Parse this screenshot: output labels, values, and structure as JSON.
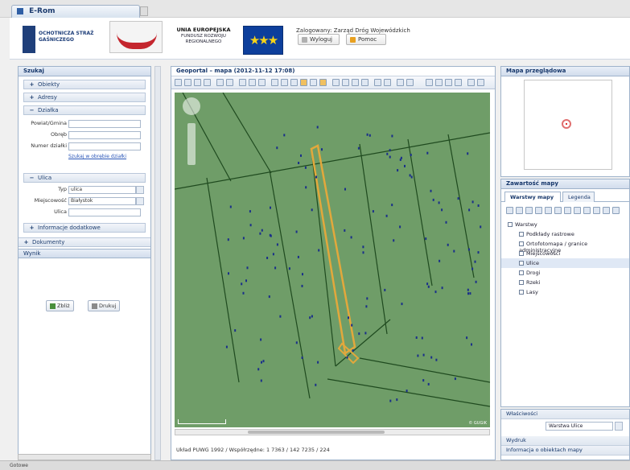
{
  "window": {
    "tab_title": "E-Rom"
  },
  "header": {
    "logo1_text": "OCHOTNICZA STRAŻ GAŚNICZEGO",
    "logo3_title": "UNIA EUROPEJSKA",
    "logo3_sub": "FUNDUSZ ROZWOJU REGIONALNEGO",
    "user_text": "Zalogowany: Zarząd Dróg Wojewódzkich",
    "btn_login": "Wyloguj",
    "btn_help": "Pomoc"
  },
  "left": {
    "title": "Szukaj",
    "acc_1": "Obiekty",
    "acc_2": "Adresy",
    "acc_3": "Działka",
    "field_1_label": "Powiat/Gmina",
    "field_2_label": "Obręb",
    "field_3_label": "Numer działki",
    "link_search": "Szukaj w obrębie działki",
    "acc_4": "Ulica",
    "type_label": "Typ",
    "type_value": "ulica",
    "city_label": "Miejscowość",
    "city_value": "Białystok",
    "street_label": "Ulica",
    "acc_5": "Informacje dodatkowe",
    "results_section": "Dokumenty",
    "results_title": "Wynik",
    "btn_zoom": "Zbliż",
    "btn_print": "Drukuj"
  },
  "map": {
    "title": "Geoportal – mapa (2012-11-12 17:08)",
    "status": "Układ PUWG 1992 / Współrzędne: 1 7363 / 142 7235 / 224",
    "copyright": "© GUGiK",
    "colors": {
      "map_bg": "#6f9d68",
      "line": "#1f4a1f",
      "highlight": "#e2a83c",
      "tree": "#1a2f8a"
    }
  },
  "right": {
    "overview_title": "Mapa przeglądowa",
    "layers_title": "Zawartość mapy",
    "tab_layers": "Warstwy mapy",
    "tab_legend": "Legenda",
    "tree": [
      {
        "label": "Warstwy",
        "indent": 0
      },
      {
        "label": "Podkłady rastrowe",
        "indent": 1
      },
      {
        "label": "Ortofotomapa / granice administracyjne",
        "indent": 1
      },
      {
        "label": "Miejscowości",
        "indent": 1
      },
      {
        "label": "Ulice",
        "indent": 1
      },
      {
        "label": "Drogi",
        "indent": 1
      },
      {
        "label": "Rzeki",
        "indent": 1
      },
      {
        "label": "Lasy",
        "indent": 1
      }
    ],
    "props_title": "Właściwości",
    "props_value": "Warstwa Ulice",
    "sec_print": "Wydruk",
    "sec_legend": "Informacja o obiektach mapy"
  },
  "footer": {
    "text": "Gotowe"
  }
}
